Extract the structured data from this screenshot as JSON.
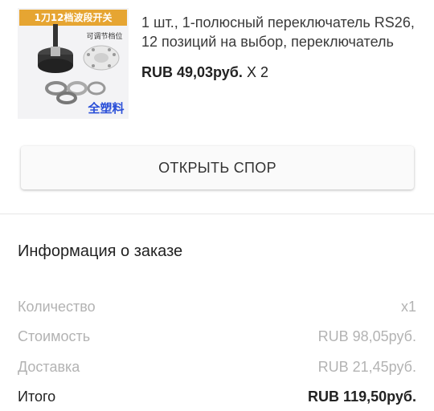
{
  "product": {
    "image_alt": "Rotary switch RS26 product photo",
    "image_text_top": "1刀12档波段开关",
    "image_text_sub": "可调节档位",
    "image_text_bottom": "全塑料",
    "title": "1 шт., 1-полюсный переключатель RS26, 12 позиций на выбор, переключатель",
    "price": "RUB 49,03руб.",
    "quantity": "X 2"
  },
  "dispute_button": {
    "label": "ОТКРЫТЬ СПОР"
  },
  "order_info": {
    "title": "Информация о заказе",
    "rows": [
      {
        "label": "Количество",
        "value": "x1"
      },
      {
        "label": "Стоимость",
        "value": "RUB 98,05руб."
      },
      {
        "label": "Доставка",
        "value": "RUB 21,45руб."
      },
      {
        "label": "Итого",
        "value": "RUB 119,50руб."
      }
    ]
  },
  "colors": {
    "image_banner": "#e6a532",
    "image_text_blue": "#2a4fd8"
  }
}
